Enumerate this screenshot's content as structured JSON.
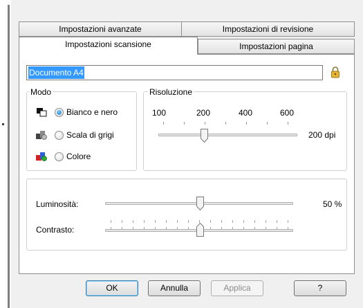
{
  "tabs": {
    "advanced": "Impostazioni avanzate",
    "review": "Impostazioni di revisione",
    "scan": "Impostazioni scansione",
    "page": "Impostazioni pagina"
  },
  "profile_name": "Documento A4",
  "mode": {
    "title": "Modo",
    "options": [
      {
        "label": "Bianco e nero",
        "checked": true
      },
      {
        "label": "Scala di grigi",
        "checked": false
      },
      {
        "label": "Colore",
        "checked": false
      }
    ]
  },
  "resolution": {
    "title": "Risoluzione",
    "scale": [
      "100",
      "200",
      "400",
      "600"
    ],
    "value_label": "200 dpi",
    "value": 200
  },
  "brightness": {
    "label": "Luminosità:",
    "value_label": "50 %",
    "value": 50
  },
  "contrast": {
    "label": "Contrasto:",
    "value": 50
  },
  "buttons": {
    "ok": "OK",
    "cancel": "Annulla",
    "apply": "Applica",
    "help": "?"
  }
}
